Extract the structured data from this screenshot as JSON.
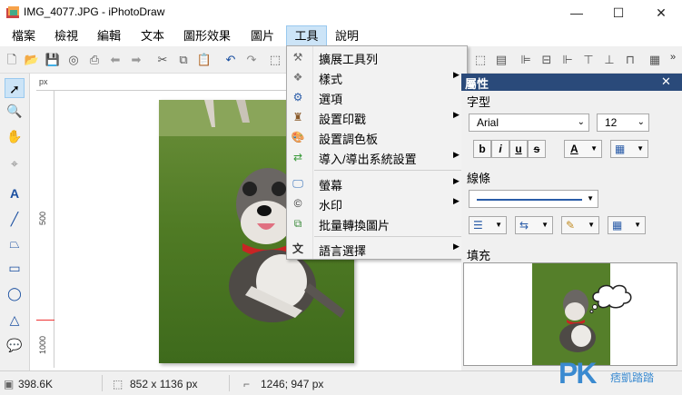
{
  "window": {
    "title": "IMG_4077.JPG - iPhotoDraw",
    "minimize_glyph": "—",
    "maximize_glyph": "☐",
    "close_glyph": "✕"
  },
  "menubar": {
    "items": [
      "檔案",
      "檢視",
      "編輯",
      "文本",
      "圖形效果",
      "圖片",
      "工具",
      "說明"
    ],
    "active": "工具"
  },
  "tools_menu": {
    "items": [
      {
        "label": "擴展工具列",
        "icon": "wrench-icon",
        "submenu": false
      },
      {
        "label": "樣式",
        "icon": "style-icon",
        "submenu": true
      },
      {
        "label": "選項",
        "icon": "gear-icon",
        "submenu": false
      },
      {
        "label": "設置印戳",
        "icon": "stamp-icon",
        "submenu": true
      },
      {
        "label": "設置調色板",
        "icon": "palette-icon",
        "submenu": false
      },
      {
        "label": "導入/導出系統設置",
        "icon": "import-export-icon",
        "submenu": true
      },
      {
        "label": "螢幕",
        "icon": "monitor-icon",
        "submenu": true
      },
      {
        "label": "水印",
        "icon": "copyright-icon",
        "submenu": true
      },
      {
        "label": "批量轉換圖片",
        "icon": "batch-convert-icon",
        "submenu": false
      },
      {
        "label": "語言選擇",
        "icon": "language-icon",
        "submenu": true
      }
    ]
  },
  "ruler": {
    "unit": "px",
    "v_labels": [
      "500",
      "1000"
    ]
  },
  "properties": {
    "header": "屬性",
    "close_glyph": "✕",
    "font_section": "字型",
    "font_name": "Arial",
    "font_size": "12",
    "bold": "b",
    "italic": "i",
    "underline": "u",
    "strike": "s",
    "color_letter": "A",
    "line_section": "線條",
    "fill_section": "填充"
  },
  "statusbar": {
    "file_size": "398.6K",
    "dimensions": "852 x 1136 px",
    "cursor": "1246; 947 px"
  },
  "watermark": {
    "logo": "PK",
    "text": "痞凱踏踏"
  },
  "colors": {
    "menu_active_bg": "#cce4f7",
    "props_header_bg": "#2a4a7a",
    "icon_blue": "#1a4fa0"
  }
}
